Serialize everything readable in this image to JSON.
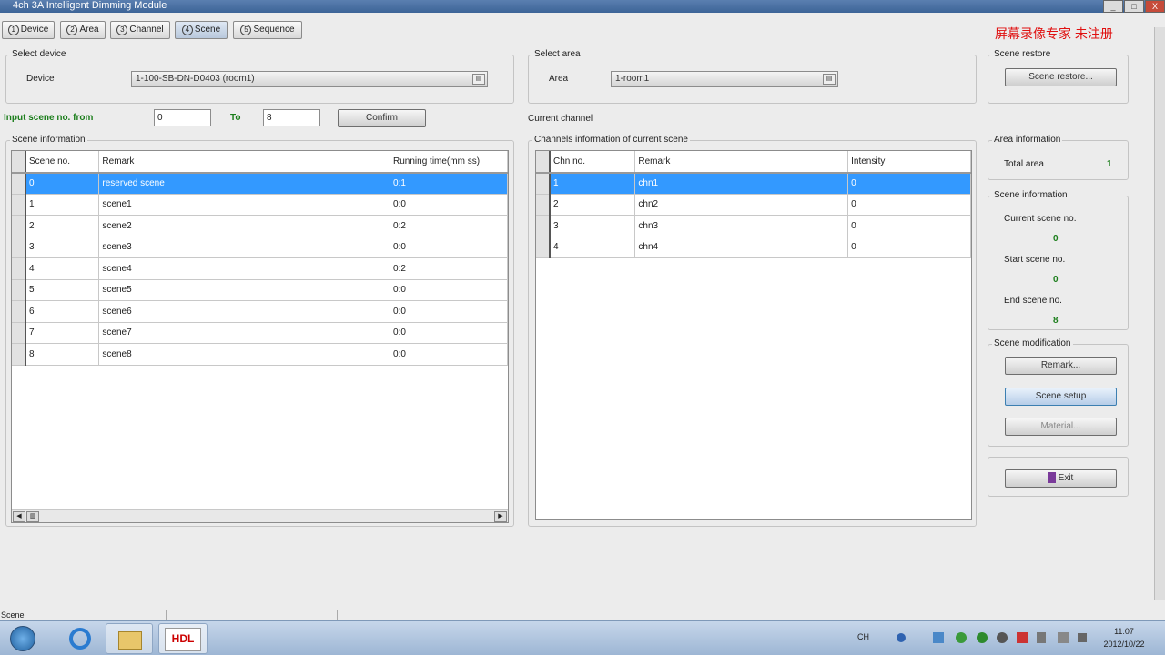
{
  "window": {
    "title": "4ch 3A Intelligent Dimming Module",
    "min": "_",
    "max": "□",
    "close": "X"
  },
  "tabs": [
    {
      "num": "1",
      "label": "Device"
    },
    {
      "num": "2",
      "label": "Area"
    },
    {
      "num": "3",
      "label": "Channel"
    },
    {
      "num": "4",
      "label": "Scene"
    },
    {
      "num": "5",
      "label": "Sequence"
    }
  ],
  "watermark": "屏幕录像专家  未注册",
  "select_device": {
    "legend": "Select device",
    "label": "Device",
    "value": "1-100-SB-DN-D0403 (room1)"
  },
  "select_area": {
    "legend": "Select area",
    "label": "Area",
    "value": "1-room1"
  },
  "scene_restore": {
    "legend": "Scene restore",
    "button": "Scene restore..."
  },
  "scene_range": {
    "label": "Input scene no. from",
    "from": "0",
    "to_label": "To",
    "to": "8",
    "confirm": "Confirm"
  },
  "current_channel_label": "Current channel",
  "scene_info": {
    "legend": "Scene information",
    "headers": [
      "Scene no.",
      "Remark",
      "Running time(mm ss)"
    ],
    "rows": [
      [
        "0",
        "reserved scene",
        "0:1"
      ],
      [
        "1",
        "scene1",
        "0:0"
      ],
      [
        "2",
        "scene2",
        "0:2"
      ],
      [
        "3",
        "scene3",
        "0:0"
      ],
      [
        "4",
        "scene4",
        "0:2"
      ],
      [
        "5",
        "scene5",
        "0:0"
      ],
      [
        "6",
        "scene6",
        "0:0"
      ],
      [
        "7",
        "scene7",
        "0:0"
      ],
      [
        "8",
        "scene8",
        "0:0"
      ]
    ],
    "selected": 0
  },
  "channels_info": {
    "legend": "Channels information of current scene",
    "headers": [
      "Chn no.",
      "Remark",
      "Intensity"
    ],
    "rows": [
      [
        "1",
        "chn1",
        "0"
      ],
      [
        "2",
        "chn2",
        "0"
      ],
      [
        "3",
        "chn3",
        "0"
      ],
      [
        "4",
        "chn4",
        "0"
      ]
    ],
    "selected": 0
  },
  "area_info": {
    "legend": "Area information",
    "label": "Total area",
    "value": "1"
  },
  "scene_side_info": {
    "legend": "Scene information",
    "current_label": "Current scene no.",
    "current": "0",
    "start_label": "Start scene no.",
    "start": "0",
    "end_label": "End scene no.",
    "end": "8"
  },
  "scene_mod": {
    "legend": "Scene modification",
    "remark": "Remark...",
    "setup": "Scene setup",
    "material": "Material..."
  },
  "exit": "Exit",
  "status": "Scene",
  "taskbar": {
    "hdl": "HDL",
    "lang": "CH",
    "time": "11:07",
    "date": "2012/10/22"
  }
}
